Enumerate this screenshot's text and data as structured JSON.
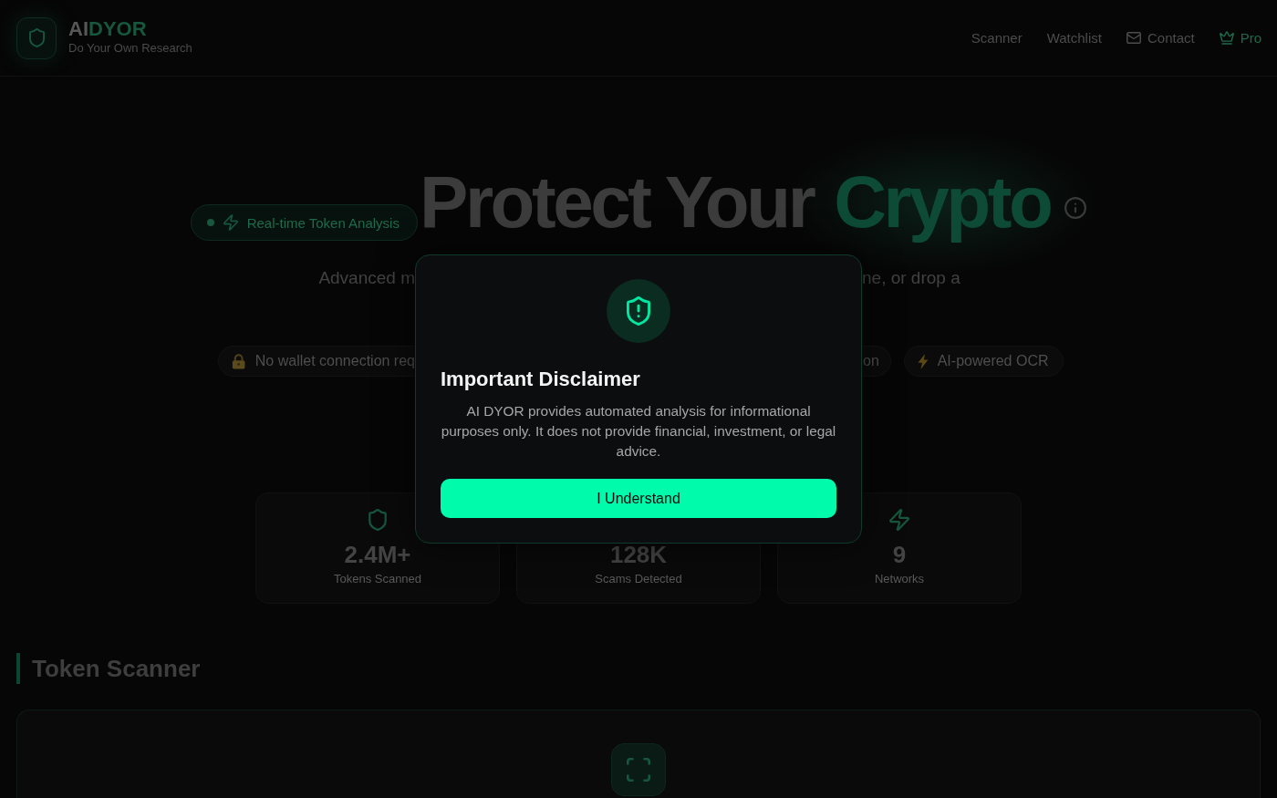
{
  "header": {
    "brand": {
      "prefix": "AI",
      "accent": "DYOR"
    },
    "tagline": "Do Your Own Research",
    "nav": [
      {
        "label": "Scanner",
        "kind": "link"
      },
      {
        "label": "Watchlist",
        "kind": "link"
      },
      {
        "label": "Contact",
        "kind": "contact"
      },
      {
        "label": "Pro",
        "kind": "pro"
      }
    ]
  },
  "hero": {
    "badge": "Real-time Token Analysis",
    "title": "Protect Your",
    "title_accent": "Crypto",
    "subtitle_left": "Advanced m",
    "subtitle_right": "ne, or drop a",
    "features_left": [
      {
        "label": "No wallet connection req",
        "kind": "wallet"
      }
    ],
    "features_right": [
      {
        "label": "on",
        "kind": "partial"
      },
      {
        "label": "AI-powered OCR",
        "kind": "ocr"
      }
    ]
  },
  "stats": [
    {
      "value": "2.4M+",
      "label": "Tokens Scanned",
      "kind": "tokens"
    },
    {
      "value": "128K",
      "label": "Scams Detected",
      "kind": "scams"
    },
    {
      "value": "9",
      "label": "Networks",
      "kind": "networks"
    }
  ],
  "scanner": {
    "title": "Token Scanner"
  },
  "disclaimer_dialog": {
    "title": "Important Disclaimer",
    "message": "AI DYOR provides automated analysis for informational purposes only. It does not provide financial, investment, or legal advice.",
    "button": "I Understand"
  }
}
